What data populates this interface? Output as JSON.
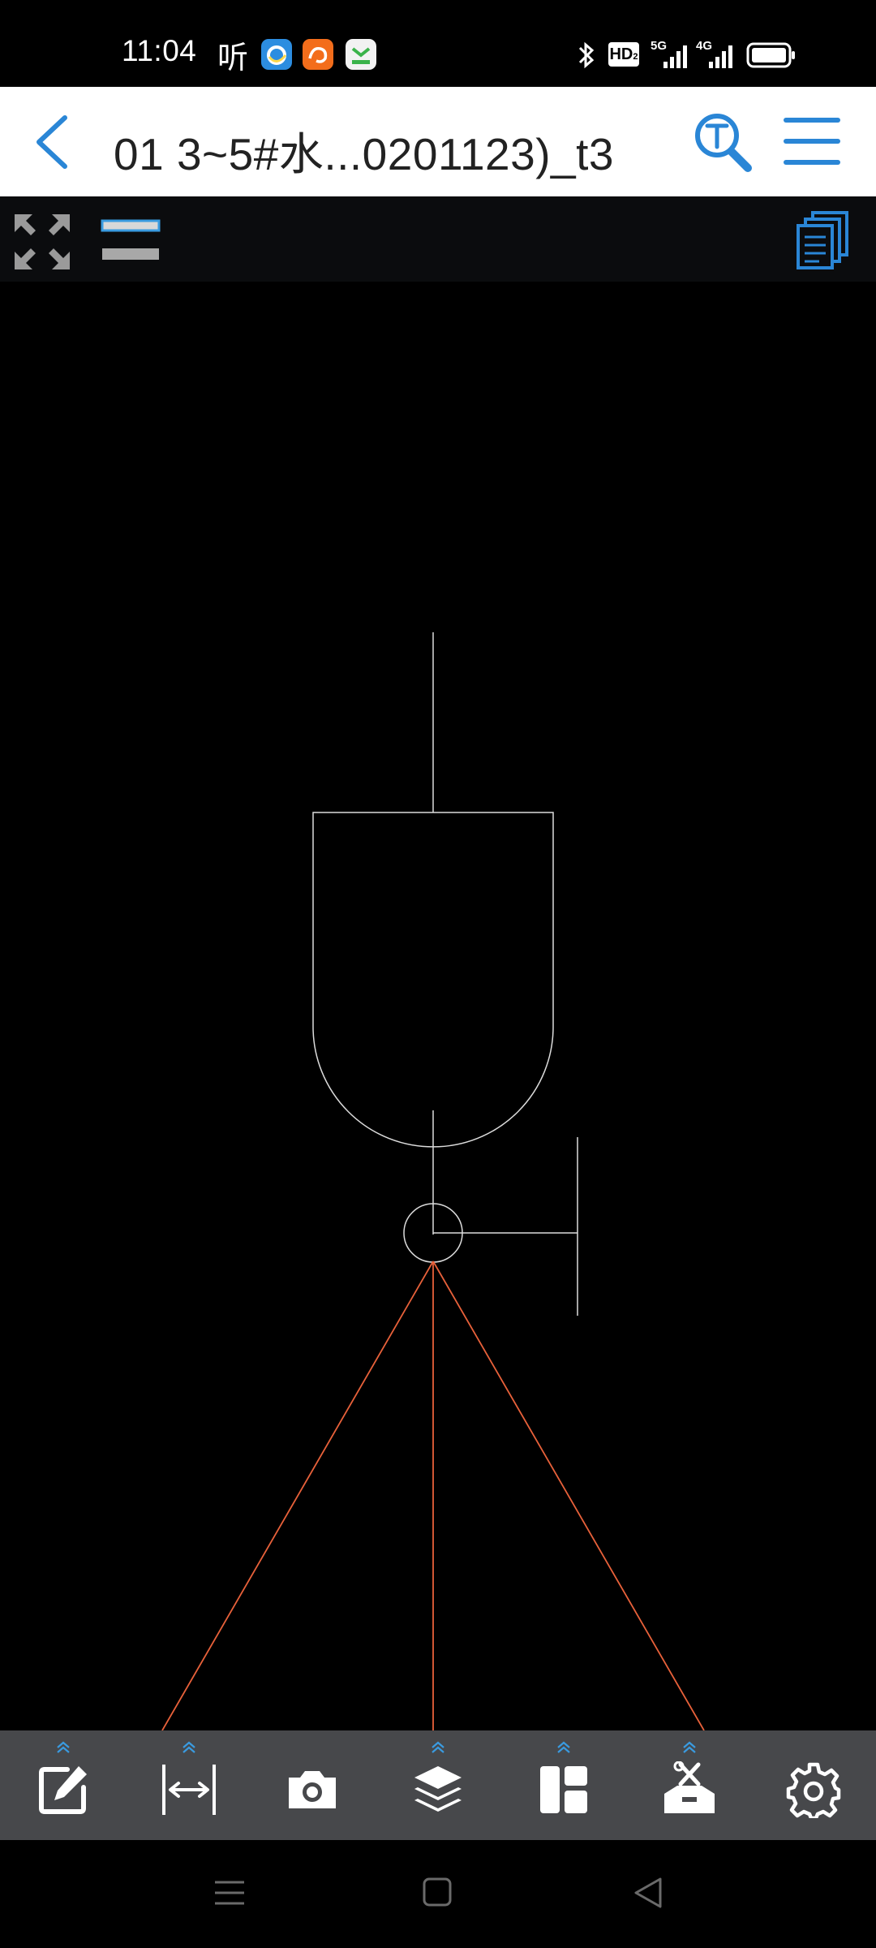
{
  "status_bar": {
    "time": "11:04",
    "ting_label": "听",
    "hd_badge": "HD",
    "hd_sub": "2",
    "signal_5g": "5G",
    "signal_4g": "4G"
  },
  "header": {
    "title": "01  3~5#水...0201123)_t3",
    "back_icon": "chevron-left-icon",
    "search_icon": "text-search-icon",
    "menu_icon": "hamburger-menu-icon"
  },
  "toolbar": {
    "expand_icon": "fullscreen-expand-icon",
    "layer_toggle_icon": "layer-toggle-icon",
    "pages_icon": "pages-stack-icon"
  },
  "bottom_tools": [
    {
      "name": "edit-tool",
      "icon": "edit-icon",
      "has_expander": true
    },
    {
      "name": "measure-tool",
      "icon": "measure-icon",
      "has_expander": true
    },
    {
      "name": "screenshot-tool",
      "icon": "camera-icon",
      "has_expander": false
    },
    {
      "name": "layers-tool",
      "icon": "layers-icon",
      "has_expander": true
    },
    {
      "name": "layout-tool",
      "icon": "layout-icon",
      "has_expander": true
    },
    {
      "name": "toolbox-tool",
      "icon": "toolbox-icon",
      "has_expander": true
    },
    {
      "name": "settings-tool",
      "icon": "settings-icon",
      "has_expander": false
    }
  ],
  "colors": {
    "accent_blue": "#2a86d6",
    "canvas_bg": "#000000",
    "drawing_line": "#ffffff",
    "drawing_accent": "#e8613a",
    "bottom_bar_bg": "#47484b"
  }
}
